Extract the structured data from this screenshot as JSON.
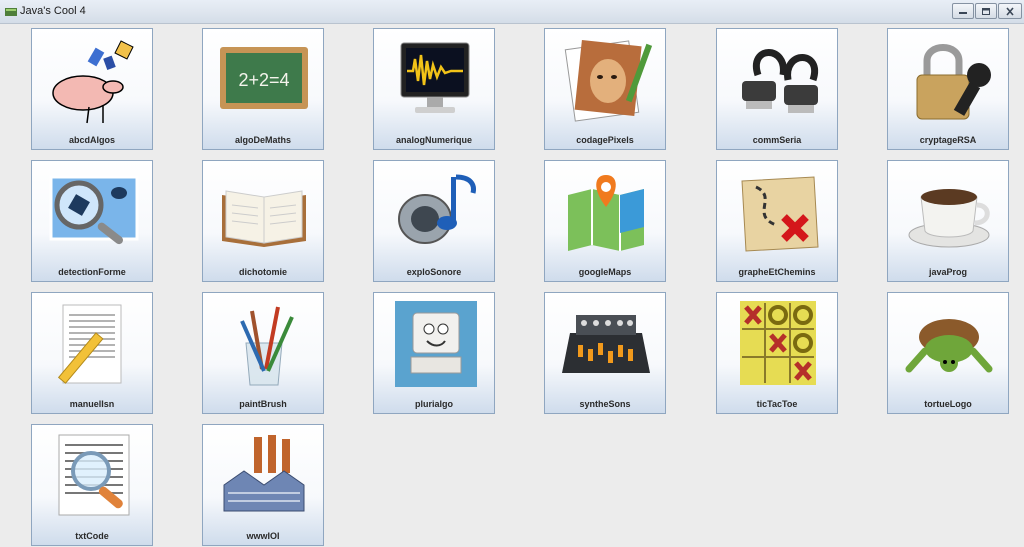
{
  "window": {
    "title": "Java's Cool 4"
  },
  "apps": [
    {
      "label": "abcdAlgos",
      "icon": "abc-algos-icon"
    },
    {
      "label": "algoDeMaths",
      "icon": "chalkboard-icon"
    },
    {
      "label": "analogNumerique",
      "icon": "waveform-monitor-icon"
    },
    {
      "label": "codagePixels",
      "icon": "painted-portrait-icon"
    },
    {
      "label": "commSeria",
      "icon": "serial-cable-icon"
    },
    {
      "label": "cryptageRSA",
      "icon": "padlock-key-icon"
    },
    {
      "label": "detectionForme",
      "icon": "magnifier-shape-icon"
    },
    {
      "label": "dichotomie",
      "icon": "open-book-icon"
    },
    {
      "label": "exploSonore",
      "icon": "speaker-note-icon"
    },
    {
      "label": "googleMaps",
      "icon": "map-pin-icon"
    },
    {
      "label": "grapheEtChemins",
      "icon": "treasure-map-icon"
    },
    {
      "label": "javaProg",
      "icon": "coffee-cup-icon"
    },
    {
      "label": "manuelIsn",
      "icon": "document-pencil-icon"
    },
    {
      "label": "paintBrush",
      "icon": "brushes-jar-icon"
    },
    {
      "label": "plurialgo",
      "icon": "computer-character-icon"
    },
    {
      "label": "syntheSons",
      "icon": "mixing-console-icon"
    },
    {
      "label": "ticTacToe",
      "icon": "tic-tac-toe-icon"
    },
    {
      "label": "tortueLogo",
      "icon": "turtle-icon"
    },
    {
      "label": "txtCode",
      "icon": "text-magnifier-icon"
    },
    {
      "label": "wwwIOI",
      "icon": "factory-icon"
    }
  ]
}
